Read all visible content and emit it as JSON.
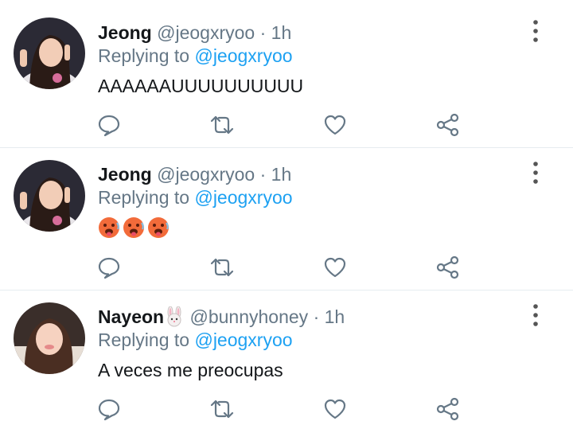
{
  "tweets": [
    {
      "name": "Jeong",
      "handle": "@jeogxryoo",
      "separator": "·",
      "time": "1h",
      "replying_label": "Replying to",
      "replying_to": "@jeogxryoo",
      "text": "AAAAAAUUUUUUUUUU"
    },
    {
      "name": "Jeong",
      "handle": "@jeogxryoo",
      "separator": "·",
      "time": "1h",
      "replying_label": "Replying to",
      "replying_to": "@jeogxryoo",
      "text": "",
      "emoji": [
        "hot-face-emoji",
        "hot-face-emoji",
        "hot-face-emoji"
      ]
    },
    {
      "name": "Nayeon",
      "name_emoji": "bunny-emoji",
      "handle": "@bunnyhoney",
      "separator": "·",
      "time": "1h",
      "replying_label": "Replying to",
      "replying_to": "@jeogxryoo",
      "text": "A veces me preocupas"
    }
  ],
  "icons": {
    "more": "vertical-dots-icon",
    "reply": "speech-bubble-icon",
    "retweet": "retweet-icon",
    "like": "heart-icon",
    "share": "share-icon"
  },
  "colors": {
    "link": "#1da1f2",
    "meta": "#657786",
    "text": "#14171a",
    "divider": "#e6ecf0"
  }
}
